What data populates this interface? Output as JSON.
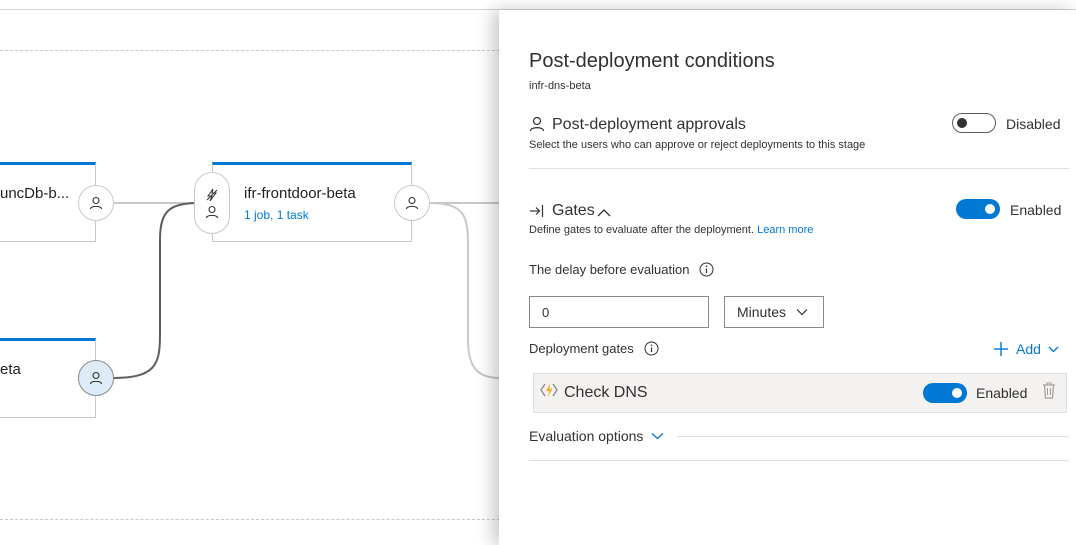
{
  "pipeline": {
    "stages": [
      {
        "name": "uncDb-b...",
        "subtitle": ""
      },
      {
        "name": "ifr-frontdoor-beta",
        "subtitle": "1 job, 1 task"
      },
      {
        "name": "eta",
        "subtitle": ""
      }
    ]
  },
  "panel": {
    "title": "Post-deployment conditions",
    "stage_name": "infr-dns-beta",
    "approvals": {
      "title": "Post-deployment approvals",
      "description": "Select the users who can approve or reject deployments to this stage",
      "toggle_state": "Disabled",
      "enabled": false
    },
    "gates": {
      "title": "Gates",
      "description": "Define gates to evaluate after the deployment.",
      "learn_more": "Learn more",
      "toggle_state": "Enabled",
      "enabled": true,
      "delay_label": "The delay before evaluation",
      "delay_value": "0",
      "delay_unit": "Minutes",
      "deployment_gates_label": "Deployment gates",
      "add_label": "Add",
      "items": [
        {
          "name": "Check DNS",
          "toggle_state": "Enabled",
          "enabled": true,
          "icon": "azure-function-icon"
        }
      ],
      "evaluation_options": "Evaluation options"
    }
  },
  "colors": {
    "accent": "#0078d4",
    "toggle_off_border": "#605e5c",
    "stage_top_border": "#0078d4",
    "gate_icon": "#f2b52f"
  }
}
